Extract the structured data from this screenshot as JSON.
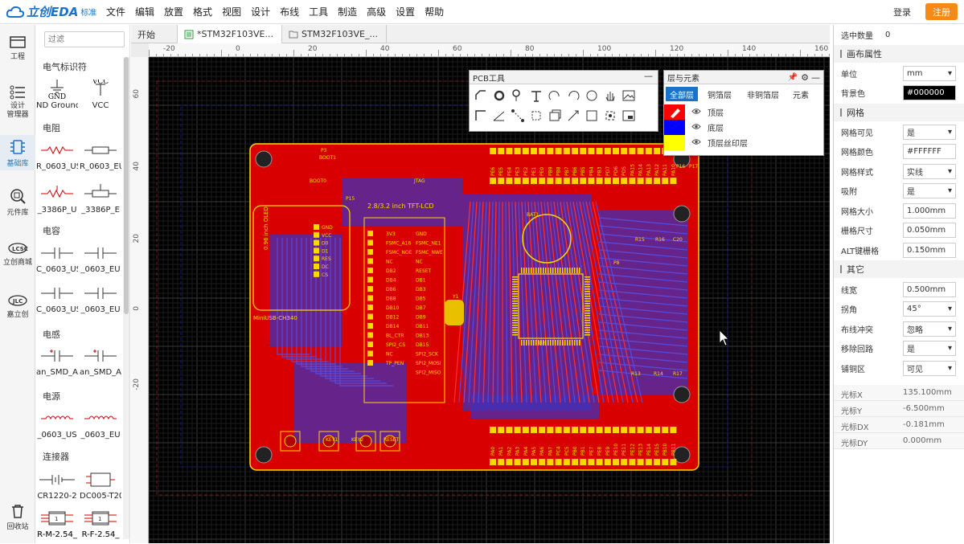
{
  "app": {
    "brand": "立创EDA",
    "edition": "标准"
  },
  "menu": [
    "文件",
    "编辑",
    "放置",
    "格式",
    "视图",
    "设计",
    "布线",
    "工具",
    "制造",
    "高级",
    "设置",
    "帮助"
  ],
  "account": {
    "login": "登录",
    "register": "注册"
  },
  "left_nav": [
    {
      "label": "工程",
      "icon": "folder-icon"
    },
    {
      "label": "设计\n管理器",
      "icon": "list-icon"
    },
    {
      "label": "基础库",
      "icon": "chip-icon"
    },
    {
      "label": "元件库",
      "icon": "search-component-icon"
    },
    {
      "label": "立创商城",
      "icon": "lcsc-icon"
    },
    {
      "label": "嘉立创",
      "icon": "jlc-icon"
    },
    {
      "label": "回收站",
      "icon": "trash-icon"
    }
  ],
  "library": {
    "filter_placeholder": "过滤",
    "categories": [
      "电气标识符",
      "电阻",
      "电容",
      "电感",
      "电源",
      "连接器"
    ],
    "items": [
      "ND Ground",
      "VCC",
      "R_0603_US",
      "R_0603_EU",
      "_3386P_U",
      "_3386P_E",
      "C_0603_US",
      "_0603_EU",
      "C_0603_US",
      "_0603_EU",
      "an_SMD_A",
      "an_SMD_A",
      "_0603_US",
      "_0603_EU",
      "CR1220-2",
      "DC005-T20",
      "R-M-2.54_",
      "R-F-2.54_",
      "R-M-2.54_",
      "R-F-2.54_"
    ],
    "symbol_texts": {
      "gnd": "GND",
      "vcc": "VCC"
    }
  },
  "tabs": [
    {
      "label": "开始"
    },
    {
      "label": "*STM32F103VE..."
    },
    {
      "label": "STM32F103VE_..."
    }
  ],
  "rulers": {
    "top": [
      "-20",
      "0",
      "20",
      "40",
      "60",
      "80",
      "100",
      "120",
      "140",
      "160"
    ],
    "left": [
      "60",
      "40",
      "20",
      "0",
      "-20"
    ]
  },
  "pcb_tools": {
    "title": "PCB工具"
  },
  "layers_window": {
    "title": "层与元素",
    "tabs": [
      "全部层",
      "铜箔层",
      "非铜箔层",
      "元素"
    ],
    "rows": [
      {
        "name": "顶层",
        "color": "#ff0000"
      },
      {
        "name": "底层",
        "color": "#0000ff"
      },
      {
        "name": "顶层丝印层",
        "color": "#ffff00"
      }
    ]
  },
  "props": {
    "selected_count_label": "选中数量",
    "selected_count": "0",
    "canvas_section": "画布属性",
    "unit_label": "单位",
    "unit": "mm",
    "bg_label": "背景色",
    "bg": "#000000",
    "grid_section": "网格",
    "grid_visible_label": "网格可见",
    "grid_visible": "是",
    "grid_color_label": "网格颜色",
    "grid_color": "#FFFFFF",
    "grid_style_label": "网格样式",
    "grid_style": "实线",
    "snap_label": "吸附",
    "snap": "是",
    "grid_size_label": "网格大小",
    "grid_size": "1.000mm",
    "grid_step_label": "栅格尺寸",
    "grid_step": "0.050mm",
    "alt_step_label": "ALT键栅格",
    "alt_step": "0.150mm",
    "other_section": "其它",
    "track_width_label": "线宽",
    "track_width": "0.500mm",
    "corner_label": "拐角",
    "corner": "45°",
    "conflict_label": "布线冲突",
    "conflict": "忽略",
    "remove_loop_label": "移除回路",
    "remove_loop": "是",
    "copper_label": "铺铜区",
    "copper": "可见",
    "cursor_x_label": "光标X",
    "cursor_x": "135.100mm",
    "cursor_y_label": "光标Y",
    "cursor_y": "-6.500mm",
    "cursor_dx_label": "光标DX",
    "cursor_dx": "-0.181mm",
    "cursor_dy_label": "光标DY",
    "cursor_dy": "0.000mm"
  },
  "pcb": {
    "labels": [
      "2.8/3.2 inch TFT-LCD",
      "MiniUSB-CH340",
      "P15",
      "JTAG",
      "BOOT1",
      "BOOT0",
      "U2",
      "P8",
      "R15",
      "R16",
      "C20",
      "R13",
      "R14",
      "R17",
      "0.96 inch OLED",
      "RESET",
      "KEY1",
      "KEY2",
      "P16",
      "P17",
      "P3",
      "BAT1",
      "Y1"
    ],
    "lcd_pins": [
      "3V3",
      "FSMC_A16",
      "FSMC_NOE",
      "NC",
      "DB2",
      "DB4",
      "DB6",
      "DB8",
      "DB10",
      "DB12",
      "DB14",
      "BL_CTR",
      "SPI2_CS",
      "NC",
      "TP_PEN"
    ],
    "lcd_pins_r": [
      "GND",
      "FSMC_NE1",
      "FSMC_NWE",
      "NC",
      "RESET",
      "DB1",
      "DB3",
      "DB5",
      "DB7",
      "DB9",
      "DB11",
      "DB13",
      "DB15",
      "SPI2_SCK",
      "SPI2_MOSI",
      "SPI2_MISO"
    ],
    "oled_pins": [
      "GND",
      "VCC",
      "D0",
      "D1",
      "RES",
      "DC",
      "CS"
    ],
    "header_top": [
      "PE6",
      "PE5",
      "PE4",
      "PE3",
      "PE2",
      "PE1",
      "PE0",
      "PB9",
      "PB8",
      "PB7",
      "PB6",
      "PB5",
      "PB4",
      "PB3",
      "PD7",
      "PD6",
      "PD5",
      "PA15",
      "PA14",
      "PA13",
      "PA12",
      "PA11",
      "PA10"
    ],
    "header_bot": [
      "PA0",
      "PA1",
      "PA2",
      "PA3",
      "PA4",
      "PA5",
      "PA6",
      "PA7",
      "PC4",
      "PC5",
      "PB0",
      "PB1",
      "PE7",
      "PE8",
      "PE9",
      "PE10",
      "PE11",
      "PE12",
      "PE13",
      "PE14",
      "PE15",
      "PB10",
      "PB11"
    ]
  }
}
